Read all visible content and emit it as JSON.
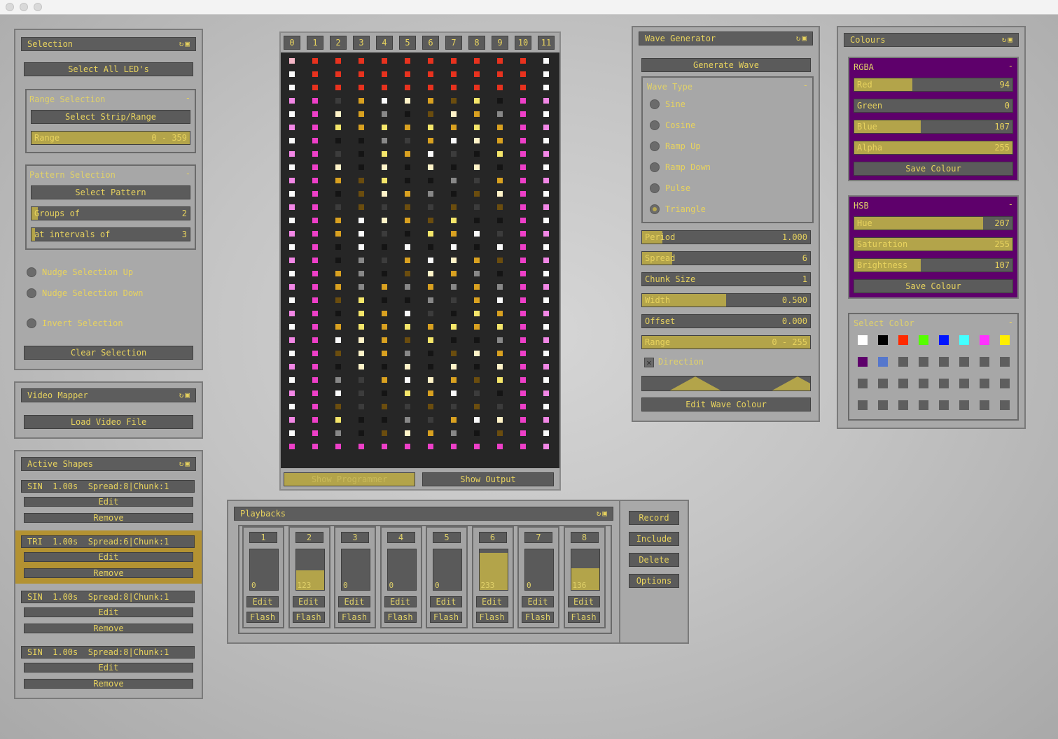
{
  "selection": {
    "title": "Selection",
    "select_all": "Select All LED's",
    "range_selection": {
      "title": "Range Selection",
      "collapse": "-",
      "select_strip": "Select Strip/Range",
      "range_label": "Range",
      "range_value": "0 - 359"
    },
    "pattern_selection": {
      "title": "Pattern Selection",
      "collapse": "-",
      "select_pattern": "Select Pattern",
      "groups_label": "Groups of",
      "groups_value": "2",
      "intervals_label": "at intervals of",
      "intervals_value": "3"
    },
    "nudge_up": "Nudge Selection Up",
    "nudge_down": "Nudge Selection Down",
    "invert": "Invert Selection",
    "clear": "Clear Selection"
  },
  "video_mapper": {
    "title": "Video Mapper",
    "load": "Load Video File"
  },
  "active_shapes": {
    "title": "Active Shapes",
    "items": [
      {
        "label": "SIN  1.00s  Spread:8|Chunk:1",
        "edit": "Edit",
        "remove": "Remove",
        "highlighted": false
      },
      {
        "label": "TRI  1.00s  Spread:6|Chunk:1",
        "edit": "Edit",
        "remove": "Remove",
        "highlighted": true
      },
      {
        "label": "SIN  1.00s  Spread:8|Chunk:1",
        "edit": "Edit",
        "remove": "Remove",
        "highlighted": false
      },
      {
        "label": "SIN  1.00s  Spread:8|Chunk:1",
        "edit": "Edit",
        "remove": "Remove",
        "highlighted": false
      }
    ]
  },
  "matrix": {
    "columns": [
      "0",
      "1",
      "2",
      "3",
      "4",
      "5",
      "6",
      "7",
      "8",
      "9",
      "10",
      "11"
    ],
    "show_programmer": "Show Programmer",
    "show_output": "Show Output"
  },
  "wave_generator": {
    "title": "Wave Generator",
    "generate": "Generate Wave",
    "wave_type": {
      "title": "Wave Type",
      "collapse": "-",
      "options": [
        "Sine",
        "Cosine",
        "Ramp Up",
        "Ramp Down",
        "Pulse",
        "Triangle"
      ],
      "selected": "Triangle"
    },
    "params": [
      {
        "label": "Period",
        "value": "1.000",
        "fill": 0.12
      },
      {
        "label": "Spread",
        "value": "6",
        "fill": 0.18
      },
      {
        "label": "Chunk Size",
        "value": "1",
        "fill": 0
      },
      {
        "label": "Width",
        "value": "0.500",
        "fill": 0.5
      },
      {
        "label": "Offset",
        "value": "0.000",
        "fill": 0
      },
      {
        "label": "Range",
        "value": "0 - 255",
        "fill": 1
      }
    ],
    "direction": "Direction",
    "direction_checked": true,
    "edit_colour": "Edit Wave Colour"
  },
  "colours": {
    "title": "Colours",
    "rgba": {
      "title": "RGBA",
      "collapse": "-",
      "sliders": [
        {
          "label": "Red",
          "value": "94",
          "fill": 0.369
        },
        {
          "label": "Green",
          "value": "0",
          "fill": 0
        },
        {
          "label": "Blue",
          "value": "107",
          "fill": 0.42
        },
        {
          "label": "Alpha",
          "value": "255",
          "fill": 1
        }
      ],
      "save": "Save Colour"
    },
    "hsb": {
      "title": "HSB",
      "collapse": "-",
      "sliders": [
        {
          "label": "Hue",
          "value": "207",
          "fill": 0.812
        },
        {
          "label": "Saturation",
          "value": "255",
          "fill": 1
        },
        {
          "label": "Brightness",
          "value": "107",
          "fill": 0.42
        }
      ],
      "save": "Save Colour"
    },
    "select_color": {
      "title": "Select Color",
      "collapse": "-",
      "swatches": [
        "#ffffff",
        "#000000",
        "#ff2a00",
        "#55ff00",
        "#0015ff",
        "#44ffff",
        "#ff33ff",
        "#ffee00",
        "#5e006b",
        "#5577cc"
      ]
    }
  },
  "playbacks": {
    "title": "Playbacks",
    "items": [
      {
        "num": "1",
        "value": "0",
        "level": 0
      },
      {
        "num": "2",
        "value": "123",
        "level": 0.48
      },
      {
        "num": "3",
        "value": "0",
        "level": 0
      },
      {
        "num": "4",
        "value": "0",
        "level": 0
      },
      {
        "num": "5",
        "value": "0",
        "level": 0
      },
      {
        "num": "6",
        "value": "233",
        "level": 0.91
      },
      {
        "num": "7",
        "value": "0",
        "level": 0
      },
      {
        "num": "8",
        "value": "136",
        "level": 0.53
      }
    ],
    "edit": "Edit",
    "flash": "Flash",
    "record": "Record",
    "include": "Include",
    "delete": "Delete",
    "options": "Options"
  },
  "colors": {
    "accent": "#e8d35e",
    "fill": "#b3a44a",
    "button": "#5b5b5b",
    "purple": "#5e006b",
    "highlight": "#b39232"
  }
}
